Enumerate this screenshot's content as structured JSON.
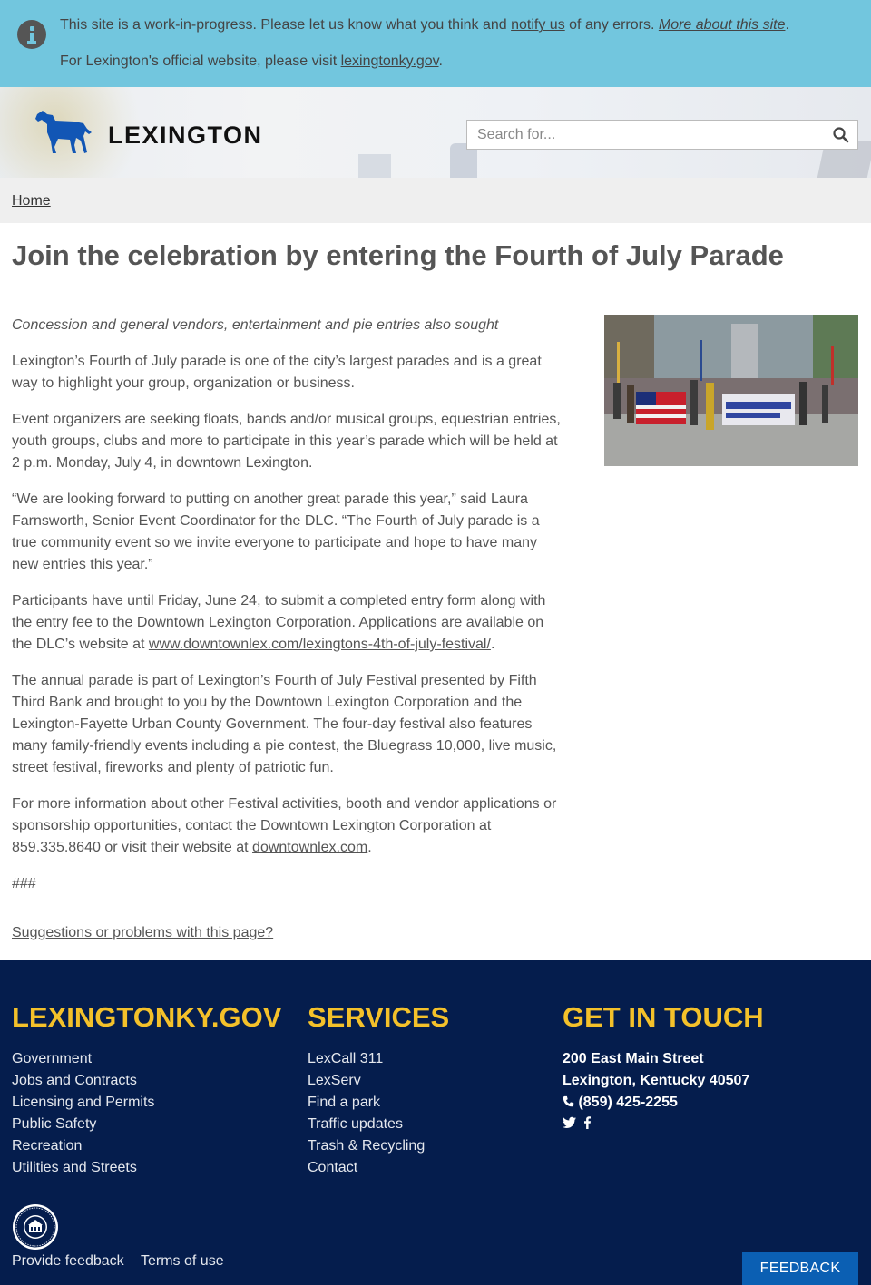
{
  "alert": {
    "line1_pre": "This site is a work-in-progress. Please let us know what you think and ",
    "line1_link": "notify us",
    "line1_mid": " of any errors. ",
    "line1_more": "More about this site",
    "line1_end": ".",
    "line2_pre": "For Lexington's official website, please visit ",
    "line2_link": "lexingtonky.gov",
    "line2_end": "."
  },
  "header": {
    "logo_text": "LEXINGTON",
    "search_placeholder": "Search for..."
  },
  "breadcrumb": {
    "home": "Home"
  },
  "article": {
    "title": "Join the celebration by entering the Fourth of July Parade",
    "subhead": "Concession and general vendors, entertainment and pie entries also sought",
    "p1": "Lexington’s Fourth of July parade is one of the city’s largest parades and is a great way to highlight your group, organization or business.",
    "p2": "Event organizers are seeking floats, bands and/or musical groups, equestrian entries, youth groups, clubs and more to participate in this year’s parade which will be held at 2 p.m. Monday, July 4, in downtown Lexington.",
    "p3": "“We are looking forward to putting on another great parade this year,” said Laura Farnsworth, Senior Event Coordinator for the DLC. “The Fourth of July parade is a true community event so we invite everyone to participate and hope to have many new entries this year.”",
    "p4_pre": "Participants have until Friday, June 24, to submit a completed entry form along with the entry fee to the Downtown Lexington Corporation. Applications are available on the DLC’s website at ",
    "p4_link": "www.downtownlex.com/lexingtons-4th-of-july-festival/",
    "p4_end": ".",
    "p5": "The annual parade is part of Lexington’s Fourth of July Festival presented by Fifth Third Bank and brought to you by the Downtown Lexington Corporation and the Lexington-Fayette Urban County Government. The four-day festival also features many family-friendly events including a pie contest, the Bluegrass 10,000, live music, street festival, fireworks and plenty of patriotic fun.",
    "p6_pre": "For more information about other Festival activities, booth and vendor applications or sponsorship opportunities, contact the Downtown Lexington Corporation at 859.335.8640 or visit their website at ",
    "p6_link": "downtownlex.com",
    "p6_end": ".",
    "end_mark": "###",
    "suggestions": "Suggestions or problems with this page?"
  },
  "footer": {
    "col1_heading": "LEXINGTONKY.GOV",
    "col1_links": [
      "Government",
      "Jobs and Contracts",
      "Licensing and Permits",
      "Public Safety",
      "Recreation",
      "Utilities and Streets"
    ],
    "col2_heading": "SERVICES",
    "col2_links": [
      "LexCall 311",
      "LexServ",
      "Find a park",
      "Traffic updates",
      "Trash & Recycling",
      "Contact"
    ],
    "col3_heading": "GET IN TOUCH",
    "address1": "200 East Main Street",
    "address2": "Lexington, Kentucky 40507",
    "phone": "(859) 425-2255",
    "provide_feedback": "Provide feedback",
    "terms": "Terms of use",
    "feedback_button": "FEEDBACK"
  },
  "colors": {
    "alert_bg": "#72c6de",
    "footer_bg": "#051d4d",
    "footer_heading": "#f4c12a",
    "feedback_button": "#0b5fb3",
    "logo_horse": "#1256b5"
  }
}
